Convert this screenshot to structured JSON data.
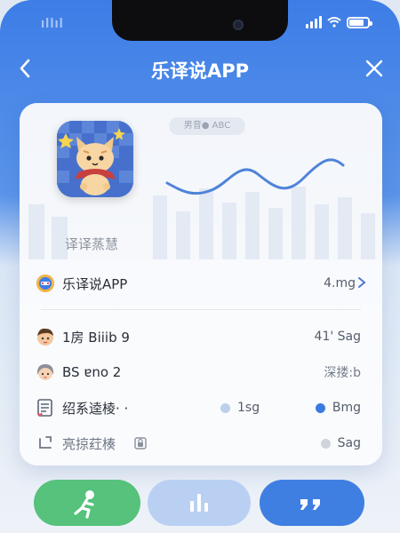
{
  "status": {
    "carrier": "ıllıl"
  },
  "nav": {
    "title": "乐译说APP"
  },
  "hero": {
    "pill_text": "男音● ABC",
    "caption": "译译蒸慧"
  },
  "rows": [
    {
      "icon": "app-logo-icon",
      "label": "乐译说APP",
      "value": "4.mg"
    },
    {
      "icon": "boy-avatar-icon",
      "label": "1房 Biiib 9",
      "value": "41' Sag"
    },
    {
      "icon": "girl-avatar-icon",
      "label": "BS ɐno 2",
      "value": "深搂:b"
    },
    {
      "icon": "document-icon",
      "label": "绍系逵棱· ·",
      "mid_value": "1sg",
      "mid_color": "#bcd0ec",
      "value": "Bmg",
      "value_color": "#3b7be0"
    },
    {
      "icon": "share-icon",
      "label": "亮掠荭楱",
      "value": "Sag",
      "value_color": "#cfd4db"
    }
  ],
  "colors": {
    "accent": "#3d7de6",
    "green": "#56c27c"
  }
}
